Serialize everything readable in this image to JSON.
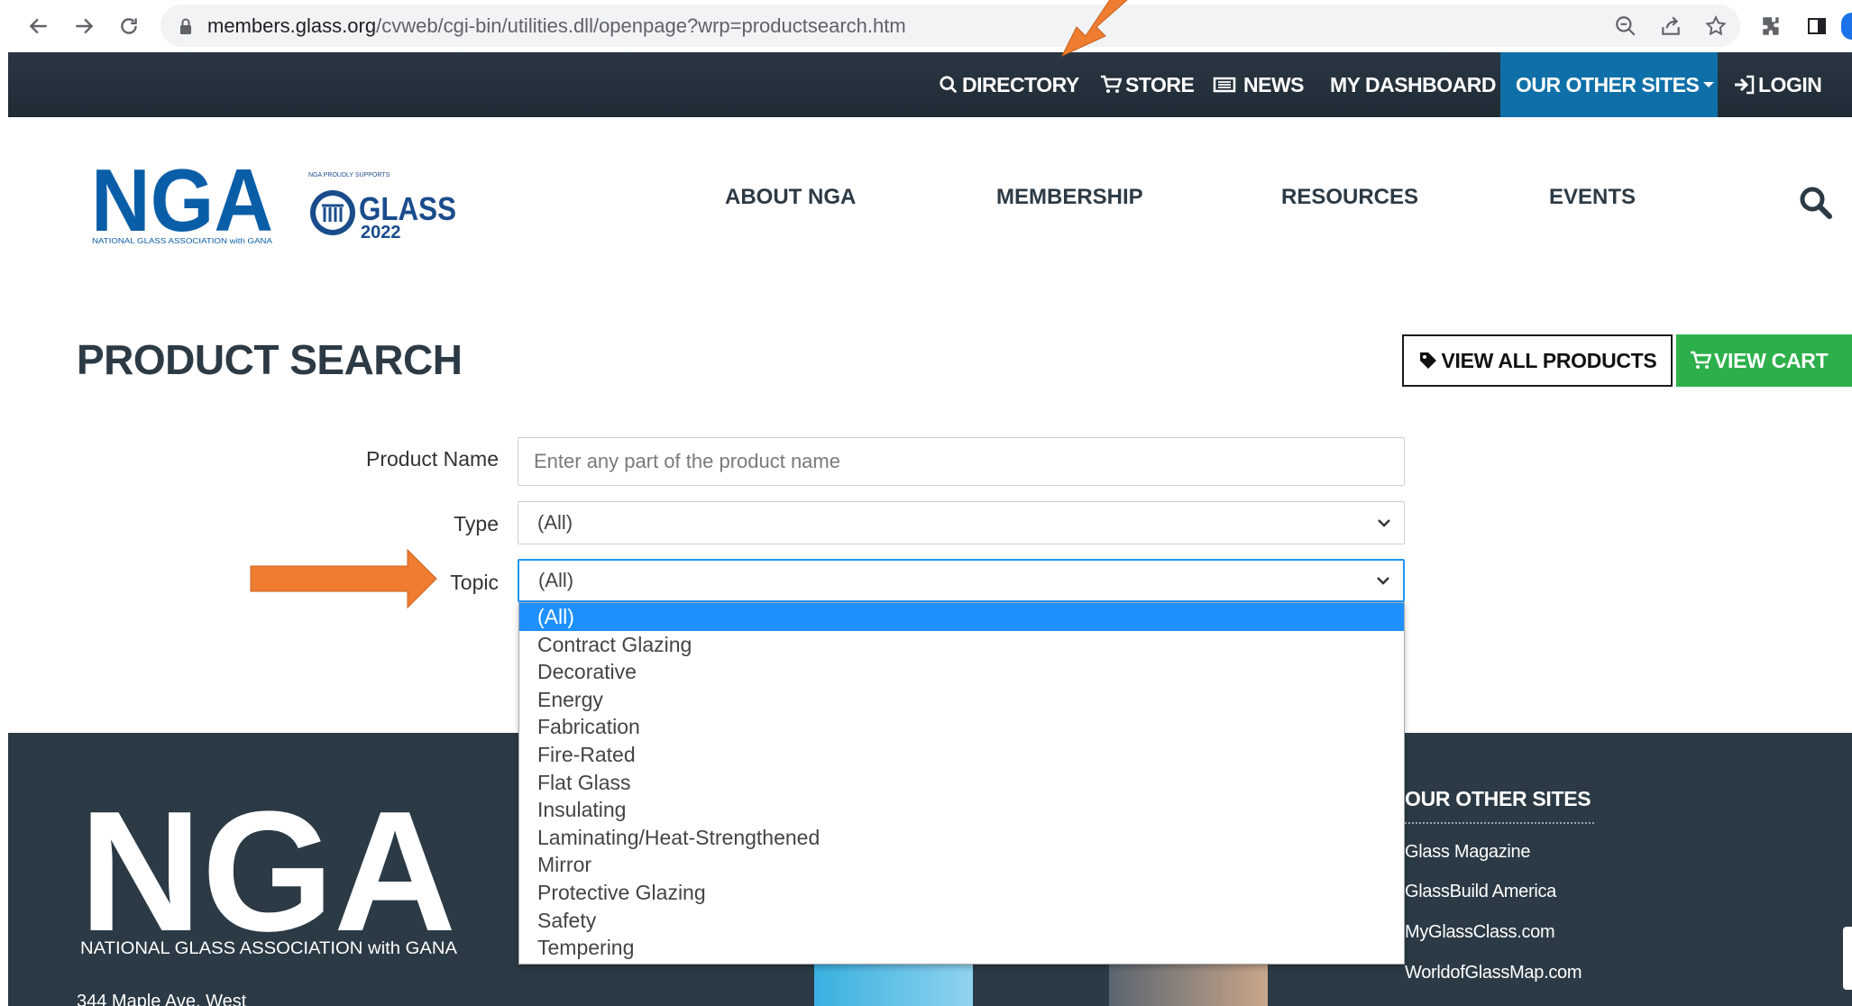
{
  "browser": {
    "url_host": "members.glass.org",
    "url_path": "/cvweb/cgi-bin/utilities.dll/openpage?wrp=productsearch.htm"
  },
  "topbar": {
    "directory": "DIRECTORY",
    "store": "STORE",
    "news": "NEWS",
    "dashboard": "MY DASHBOARD",
    "other_sites": "OUR OTHER SITES",
    "login": "LOGIN"
  },
  "header": {
    "logo_text": "NGA",
    "logo_subtext": "NATIONAL GLASS ASSOCIATION with GANA",
    "glass_logo_small": "NGA PROUDLY SUPPORTS",
    "glass_logo_text": "GLASS",
    "glass_logo_year": "2022",
    "nav": [
      "ABOUT NGA",
      "MEMBERSHIP",
      "RESOURCES",
      "EVENTS"
    ]
  },
  "page": {
    "title": "PRODUCT SEARCH",
    "view_all_label": "VIEW ALL PRODUCTS",
    "view_cart_label": "VIEW CART"
  },
  "form": {
    "product_name_label": "Product Name",
    "product_name_placeholder": "Enter any part of the product name",
    "type_label": "Type",
    "type_value": "(All)",
    "topic_label": "Topic",
    "topic_value": "(All)",
    "topic_options": [
      "(All)",
      "Contract Glazing",
      "Decorative",
      "Energy",
      "Fabrication",
      "Fire-Rated",
      "Flat Glass",
      "Insulating",
      "Laminating/Heat-Strengthened",
      "Mirror",
      "Protective Glazing",
      "Safety",
      "Tempering"
    ]
  },
  "footer": {
    "logo_text": "NGA",
    "logo_subtext": "NATIONAL GLASS ASSOCIATION with GANA",
    "address": "344 Maple Ave. West",
    "other_sites_heading": "OUR OTHER SITES",
    "links": [
      "Glass Magazine",
      "GlassBuild America",
      "MyGlassClass.com",
      "WorldofGlassMap.com"
    ]
  },
  "colors": {
    "topbar_bg": "#1f2b35",
    "other_sites_bg": "#0f6fa8",
    "cart_green": "#2db04b",
    "logo_blue": "#0a5ea8",
    "selected_blue": "#1e90ff",
    "arrow_orange": "#ee7d31",
    "footer_bg": "#2b3a45"
  }
}
